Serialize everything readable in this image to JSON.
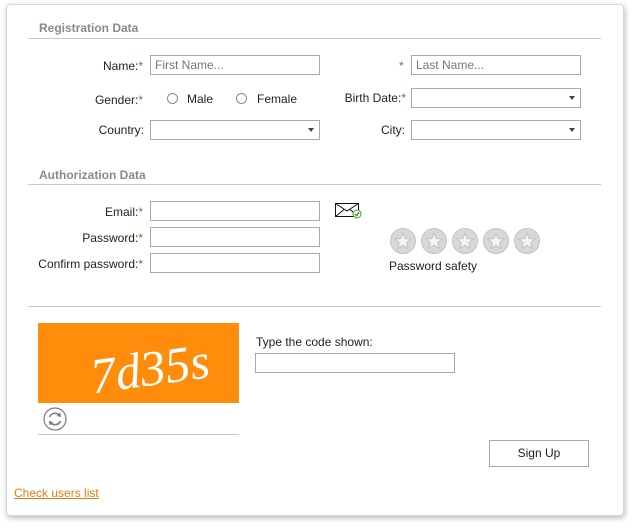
{
  "registration": {
    "section_title": "Registration Data",
    "name_label": "Name:",
    "required_marker": "*",
    "first_name_placeholder": "First Name...",
    "last_name_placeholder": "Last Name...",
    "gender_label": "Gender:",
    "gender_options": [
      "Male",
      "Female"
    ],
    "birth_date_label": "Birth Date:",
    "country_label": "Country:",
    "city_label": "City:"
  },
  "authorization": {
    "section_title": "Authorization Data",
    "email_label": "Email:",
    "password_label": "Password:",
    "confirm_password_label": "Confirm password:",
    "password_safety_label": "Password safety",
    "password_safety_stars": 0
  },
  "captcha": {
    "code_text": "7d35s",
    "prompt_label": "Type the code shown:",
    "background_color": "#ff8c0a",
    "refresh_icon": "refresh-icon"
  },
  "actions": {
    "sign_up_label": "Sign Up",
    "check_users_link": "Check users list"
  },
  "colors": {
    "required_marker": "#3a9a1e",
    "section_title": "#8a8a8a",
    "link": "#e87c0c"
  }
}
